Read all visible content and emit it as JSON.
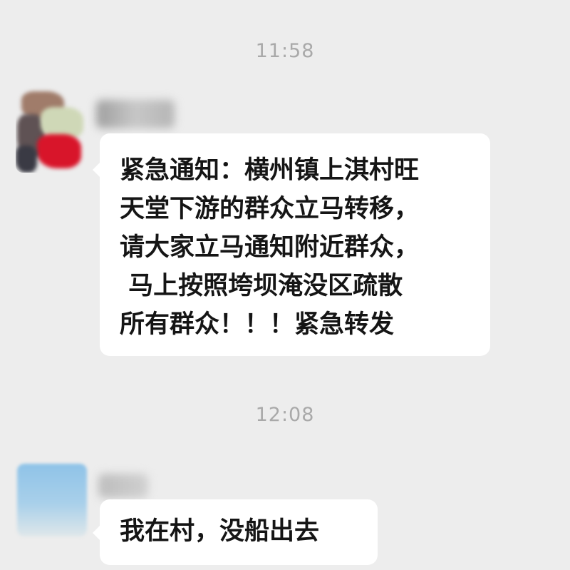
{
  "chat": {
    "messages": [
      {
        "timestamp": "11:58",
        "lines": [
          "紧急通知：横州镇上淇村旺",
          "天堂下游的群众立马转移，",
          "请大家立马通知附近群众，",
          " 马上按照垮坝淹没区疏散",
          "所有群众！！！紧急转发"
        ]
      },
      {
        "timestamp": "12:08",
        "lines": [
          "我在村，没船出去"
        ]
      }
    ]
  },
  "colors": {
    "background": "#ededed",
    "bubble": "#ffffff",
    "timestamp": "#a9a9a9",
    "text": "#151515"
  },
  "icons": [
    "avatar-blurred",
    "sender-name-blurred"
  ]
}
